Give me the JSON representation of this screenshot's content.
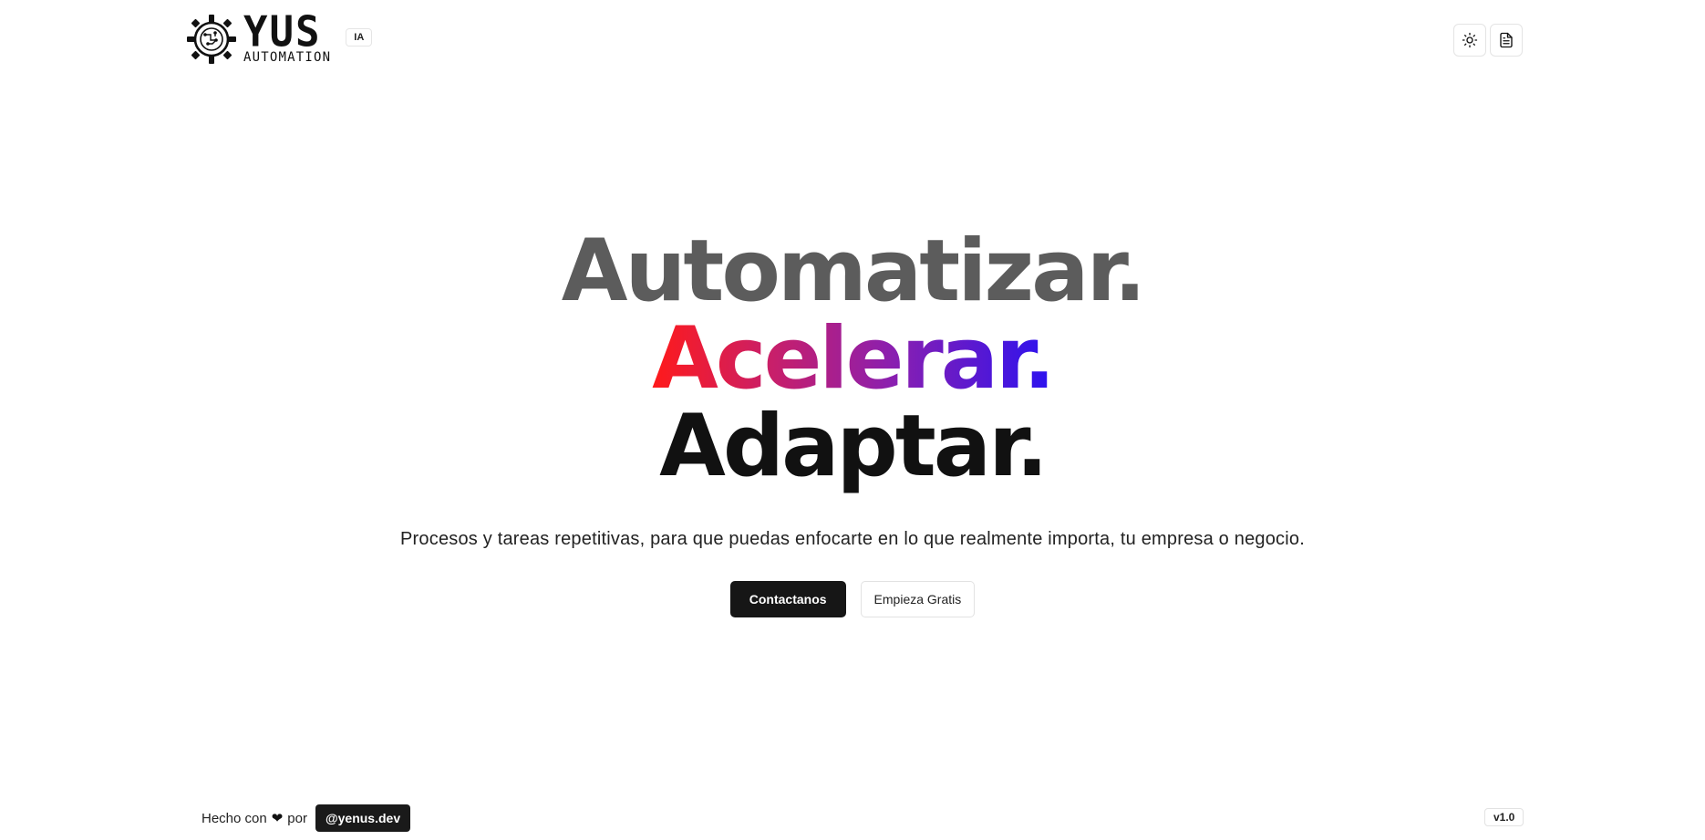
{
  "brand": {
    "name": "YUS",
    "tagline": "AUTOMATION",
    "badge": "IA"
  },
  "header": {
    "theme_toggle_icon": "sun-icon",
    "docs_icon": "document-icon"
  },
  "hero": {
    "line1": "Automatizar.",
    "line2": "Acelerar.",
    "line3": "Adaptar.",
    "subtitle": "Procesos y tareas repetitivas, para que puedas enfocarte en lo que realmente importa, tu empresa o negocio.",
    "primary_cta": "Contactanos",
    "secondary_cta": "Empieza Gratis"
  },
  "footer": {
    "made_with": "Hecho con",
    "by": "por",
    "handle": "@yenus.dev",
    "version": "v1.0"
  },
  "colors": {
    "gradient_start": "#ff1a1a",
    "gradient_end": "#2b12f0",
    "primary_button": "#161616"
  }
}
